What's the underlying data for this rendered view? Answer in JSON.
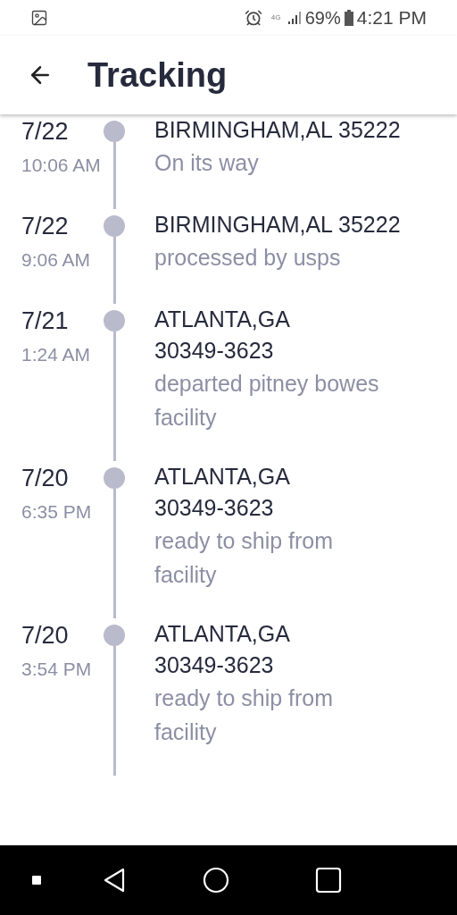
{
  "status_bar": {
    "battery": "69%",
    "time": "4:21 PM",
    "network": "4G"
  },
  "header": {
    "title": "Tracking"
  },
  "events": [
    {
      "date": "7/22",
      "time": "10:06 AM",
      "location": "BIRMINGHAM,AL 35222",
      "description": "On its way"
    },
    {
      "date": "7/22",
      "time": "9:06 AM",
      "location": "BIRMINGHAM,AL 35222",
      "description": "processed by usps"
    },
    {
      "date": "7/21",
      "time": "1:24 AM",
      "location": "ATLANTA,GA\n30349-3623",
      "description": "departed pitney bowes\nfacility"
    },
    {
      "date": "7/20",
      "time": "6:35 PM",
      "location": "ATLANTA,GA\n30349-3623",
      "description": "ready to ship from\nfacility"
    },
    {
      "date": "7/20",
      "time": "3:54 PM",
      "location": "ATLANTA,GA\n30349-3623",
      "description": "ready to ship from\nfacility"
    }
  ]
}
